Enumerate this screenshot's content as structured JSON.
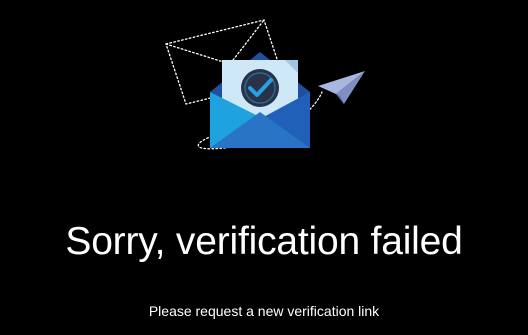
{
  "message": {
    "title": "Sorry, verification failed",
    "subtitle": "Please request a new verification link"
  },
  "illustration": {
    "icon": "verification-envelope-icon",
    "check_icon": "checkmark-icon",
    "paper_plane_icon": "paper-plane-icon",
    "outline_envelope_icon": "envelope-outline-icon"
  },
  "colors": {
    "background": "#000000",
    "text": "#ffffff",
    "envelope_light": "#1fa2e0",
    "envelope_dark": "#2160b8",
    "letter": "#cfe8f7",
    "badge": "#2a3247",
    "check": "#26a0e6",
    "plane": "#8f9fcf"
  }
}
